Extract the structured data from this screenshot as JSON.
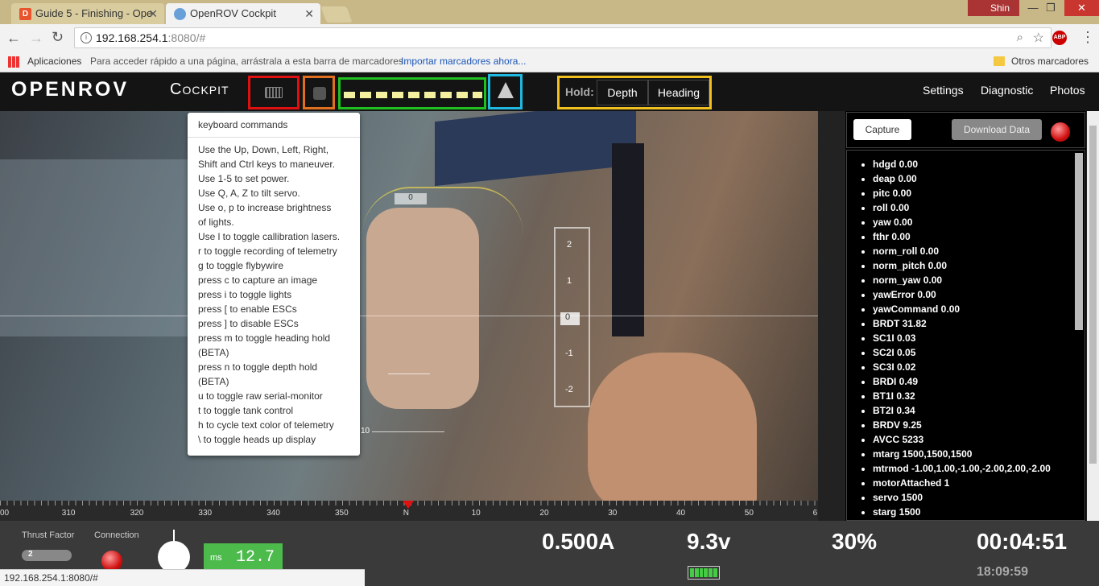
{
  "browser": {
    "tabs": [
      {
        "label": "Guide 5 - Finishing - Ope",
        "icon_letter": "D"
      },
      {
        "label": "OpenROV Cockpit"
      }
    ],
    "user": "Shin",
    "url_host": "192.168.254.1",
    "url_rest": ":8080/#",
    "bookmarks": {
      "apps": "Aplicaciones",
      "hint": "Para acceder rápido a una página, arrástrala a esta barra de marcadores.",
      "import": "Importar marcadores ahora...",
      "others": "Otros marcadores"
    },
    "abp": "ABP",
    "status_url": "192.168.254.1:8080/#"
  },
  "cockpit": {
    "logo": "OPENROV",
    "title": "Cockpit",
    "hold_label": "Hold:",
    "hold_depth": "Depth",
    "hold_heading": "Heading",
    "nav": [
      "Settings",
      "Diagnostic",
      "Photos"
    ]
  },
  "keyboard_popup": {
    "title": "keyboard commands",
    "lines": [
      "Use the Up, Down, Left, Right,",
      "Shift and Ctrl keys to maneuver.",
      "Use 1-5 to set power.",
      "Use Q, A, Z to tilt servo.",
      "Use o, p to increase brightness",
      "of lights.",
      "Use l to toggle callibration lasers.",
      "r to toggle recording of telemetry",
      "g to toggle flybywire",
      "press c to capture an image",
      "press i to toggle lights",
      "press [ to enable ESCs",
      "press ] to disable ESCs",
      "press m to toggle heading hold",
      "(BETA)",
      "press n to toggle depth hold",
      "(BETA)",
      "u to toggle raw serial-monitor",
      "t to toggle tank control",
      "h to cycle text color of telemetry",
      "\\ to toggle heads up display"
    ]
  },
  "hud": {
    "pitch_top": "0",
    "pitch_bottom": "10",
    "depth_ticks": [
      "2",
      "1",
      "0",
      "-1",
      "-2"
    ],
    "compass": [
      "00",
      "310",
      "320",
      "330",
      "340",
      "350",
      "N",
      "10",
      "20",
      "30",
      "40",
      "50",
      "6"
    ]
  },
  "right_panel": {
    "capture": "Capture",
    "download": "Download Data",
    "telemetry": [
      "hdgd 0.00",
      "deap 0.00",
      "pitc 0.00",
      "roll 0.00",
      "yaw 0.00",
      "fthr 0.00",
      "norm_roll 0.00",
      "norm_pitch 0.00",
      "norm_yaw 0.00",
      "yawError 0.00",
      "yawCommand 0.00",
      "BRDT 31.82",
      "SC1I 0.03",
      "SC2I 0.05",
      "SC3I 0.02",
      "BRDI 0.49",
      "BT1I 0.32",
      "BT2I 0.34",
      "BRDV 9.25",
      "AVCC 5233",
      "mtarg 1500,1500,1500",
      "mtrmod -1.00,1.00,-1.00,-2.00,2.00,-2.00",
      "motorAttached 1",
      "servo 1500",
      "starg 1500"
    ]
  },
  "footer": {
    "thrust_label": "Thrust Factor",
    "thrust_value": "2",
    "connection_label": "Connection",
    "ms_label": "ms",
    "ms_value": "12.7",
    "current": "0.500A",
    "voltage": "9.3v",
    "percent": "30%",
    "elapsed": "00:04:51",
    "clock": "18:09:59"
  },
  "colors": {
    "red": "#e01010",
    "orange": "#e07020",
    "green": "#20c020",
    "cyan": "#20b8e0",
    "yellow": "#f0c020"
  }
}
